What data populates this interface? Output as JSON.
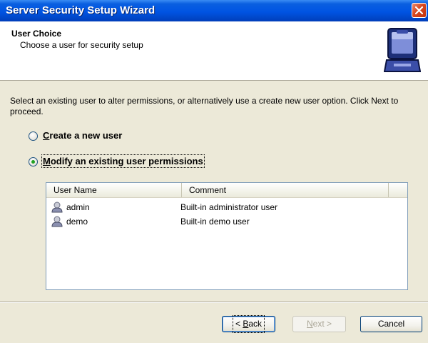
{
  "window": {
    "title": "Server Security Setup Wizard"
  },
  "header": {
    "title": "User Choice",
    "subtitle": "Choose a user for security setup",
    "icon": "computer-icon"
  },
  "instruction": "Select an existing user to alter permissions, or alternatively use a create new user option. Click Next to proceed.",
  "options": [
    {
      "access_key": "C",
      "rest": "reate a new user",
      "selected": false
    },
    {
      "access_key": "M",
      "rest": "odify an existing user permissions",
      "selected": true
    }
  ],
  "user_list": {
    "columns": [
      "User Name",
      "Comment"
    ],
    "rows": [
      {
        "name": "admin",
        "comment": "Built-in administrator user",
        "icon": "user-icon"
      },
      {
        "name": "demo",
        "comment": "Built-in demo user",
        "icon": "user-icon"
      }
    ]
  },
  "buttons": {
    "back": {
      "prefix": "< ",
      "key": "B",
      "rest": "ack"
    },
    "next": {
      "key": "N",
      "rest": "ext",
      "suffix": " >",
      "enabled": false
    },
    "cancel": "Cancel"
  },
  "colors": {
    "titlebar": "#0054e3",
    "close": "#d9481f",
    "dialog": "#ece9d8",
    "radio_selected": "#21a121"
  }
}
